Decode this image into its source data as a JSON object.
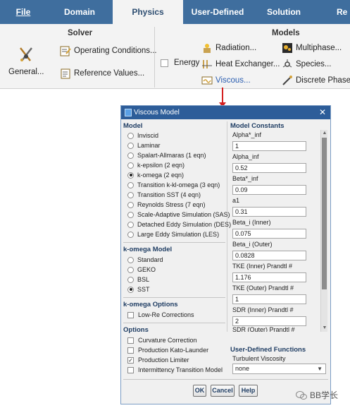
{
  "ribbon": {
    "tabs": [
      {
        "label": "File",
        "active": false
      },
      {
        "label": "Domain",
        "active": false
      },
      {
        "label": "Physics",
        "active": true
      },
      {
        "label": "User-Defined",
        "active": false
      },
      {
        "label": "Solution",
        "active": false
      },
      {
        "label": "Re",
        "active": false
      }
    ],
    "solver": {
      "title": "Solver",
      "general": "General...",
      "operating_conditions": "Operating Conditions...",
      "reference_values": "Reference Values..."
    },
    "models": {
      "title": "Models",
      "energy": "Energy",
      "radiation": "Radiation...",
      "heat_exchanger": "Heat Exchanger...",
      "viscous": "Viscous...",
      "multiphase": "Multiphase...",
      "species": "Species...",
      "discrete_phase": "Discrete Phase..."
    }
  },
  "dialog": {
    "title": "Viscous Model",
    "model": {
      "heading": "Model",
      "options": [
        {
          "label": "Inviscid",
          "selected": false
        },
        {
          "label": "Laminar",
          "selected": false
        },
        {
          "label": "Spalart-Allmaras (1 eqn)",
          "selected": false
        },
        {
          "label": "k-epsilon (2 eqn)",
          "selected": false
        },
        {
          "label": "k-omega (2 eqn)",
          "selected": true
        },
        {
          "label": "Transition k-kl-omega (3 eqn)",
          "selected": false
        },
        {
          "label": "Transition SST (4 eqn)",
          "selected": false
        },
        {
          "label": "Reynolds Stress (7 eqn)",
          "selected": false
        },
        {
          "label": "Scale-Adaptive Simulation (SAS)",
          "selected": false
        },
        {
          "label": "Detached Eddy Simulation (DES)",
          "selected": false
        },
        {
          "label": "Large Eddy Simulation (LES)",
          "selected": false
        }
      ]
    },
    "komega_model": {
      "heading": "k-omega Model",
      "options": [
        {
          "label": "Standard",
          "selected": false
        },
        {
          "label": "GEKO",
          "selected": false
        },
        {
          "label": "BSL",
          "selected": false
        },
        {
          "label": "SST",
          "selected": true
        }
      ]
    },
    "komega_options": {
      "heading": "k-omega Options",
      "low_re": {
        "label": "Low-Re Corrections",
        "checked": false
      }
    },
    "options": {
      "heading": "Options",
      "items": [
        {
          "label": "Curvature Correction",
          "checked": false
        },
        {
          "label": "Production Kato-Launder",
          "checked": false
        },
        {
          "label": "Production Limiter",
          "checked": true
        },
        {
          "label": "Intermittency Transition Model",
          "checked": false
        }
      ]
    },
    "model_constants": {
      "heading": "Model Constants",
      "items": [
        {
          "label": "Alpha*_inf",
          "value": "1"
        },
        {
          "label": "Alpha_inf",
          "value": "0.52"
        },
        {
          "label": "Beta*_inf",
          "value": "0.09"
        },
        {
          "label": "a1",
          "value": "0.31"
        },
        {
          "label": "Beta_i (Inner)",
          "value": "0.075"
        },
        {
          "label": "Beta_i (Outer)",
          "value": "0.0828"
        },
        {
          "label": "TKE (Inner) Prandtl #",
          "value": "1.176"
        },
        {
          "label": "TKE (Outer) Prandtl #",
          "value": "1"
        },
        {
          "label": "SDR (Inner) Prandtl #",
          "value": "2"
        },
        {
          "label": "SDR (Outer) Prandtl #",
          "value": ""
        }
      ]
    },
    "udf": {
      "heading": "User-Defined Functions",
      "turbulent_viscosity_label": "Turbulent Viscosity",
      "turbulent_viscosity_value": "none"
    },
    "buttons": {
      "ok": "OK",
      "cancel": "Cancel",
      "help": "Help"
    }
  },
  "watermark": "BB学长",
  "colors": {
    "tabbar": "#3f6e9e",
    "dialog_title": "#2d5d99",
    "heading": "#1f3d63",
    "arrow": "#d42020"
  }
}
